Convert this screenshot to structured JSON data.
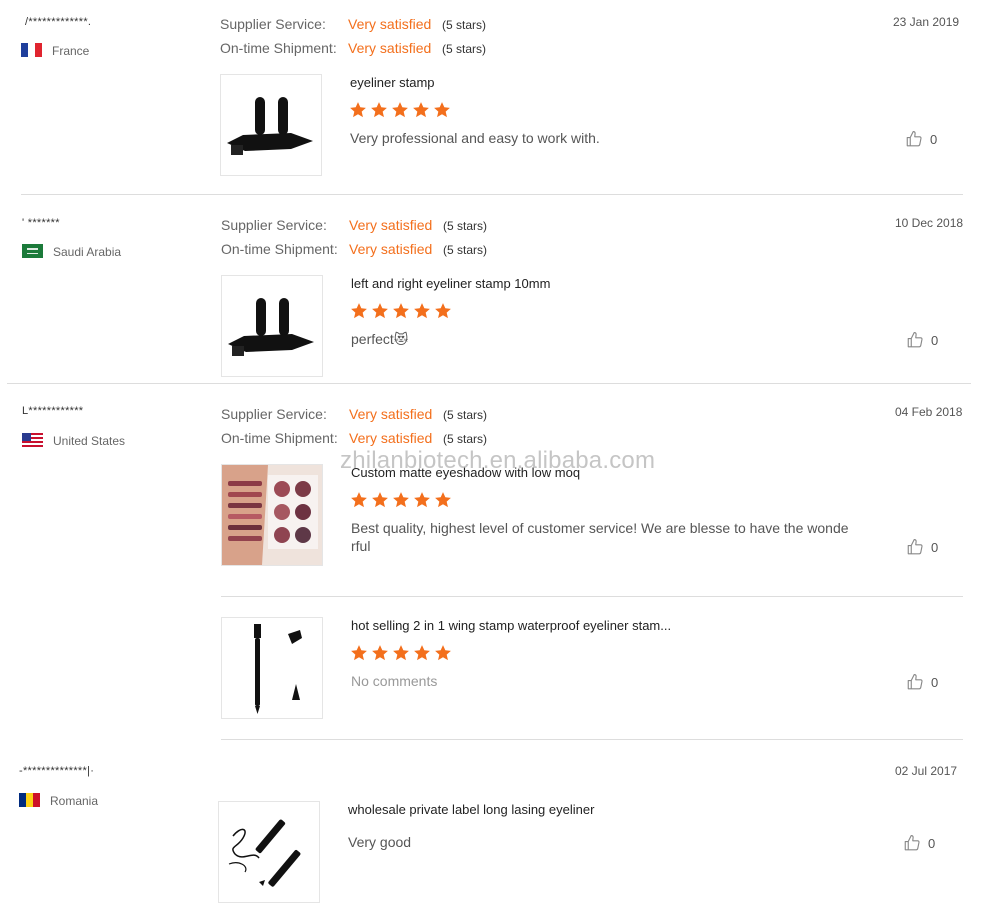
{
  "labels": {
    "supplier_service": "Supplier Service:",
    "ontime_shipment": "On-time Shipment:"
  },
  "colors": {
    "accent": "#f36f1c",
    "star": "#f36f1c"
  },
  "reviews": [
    {
      "buyer": "/*************.",
      "country": "France",
      "date": "23 Jan 2019",
      "supplier_rating": "Very satisfied",
      "supplier_stars": "(5 stars)",
      "shipment_rating": "Very satisfied",
      "shipment_stars": "(5 stars)",
      "items": [
        {
          "product": "eyeliner stamp",
          "stars": 5,
          "comment": "Very professional and easy to work with.",
          "likes": "0",
          "image": "eyeliner-stamp-photo"
        }
      ]
    },
    {
      "buyer": "' *******",
      "country": "Saudi Arabia",
      "date": "10 Dec 2018",
      "supplier_rating": "Very satisfied",
      "supplier_stars": "(5 stars)",
      "shipment_rating": "Very satisfied",
      "shipment_stars": "(5 stars)",
      "items": [
        {
          "product": "left and right eyeliner stamp 10mm",
          "stars": 5,
          "comment": "perfect😻",
          "likes": "0",
          "image": "eyeliner-stamp-photo"
        }
      ]
    },
    {
      "buyer": "L************",
      "country": "United States",
      "date": "04 Feb 2018",
      "supplier_rating": "Very satisfied",
      "supplier_stars": "(5 stars)",
      "shipment_rating": "Very satisfied",
      "shipment_stars": "(5 stars)",
      "items": [
        {
          "product": "Custom matte eyeshadow with low moq",
          "stars": 5,
          "comment": "Best quality, highest level of customer service! We are blesse to have the wonde rful",
          "likes": "0",
          "image": "eyeshadow-swatch-photo"
        },
        {
          "product": "hot selling 2 in 1 wing stamp waterproof eyeliner stam...",
          "stars": 5,
          "comment": "No comments",
          "likes": "0",
          "image": "eyeliner-pen-photo"
        }
      ]
    },
    {
      "buyer": "-**************|·",
      "country": "Romania",
      "date": "02 Jul 2017",
      "items": [
        {
          "product": "wholesale private label long lasing eyeliner",
          "comment": "Very good",
          "likes": "0",
          "image": "liquid-eyeliner-photo"
        }
      ]
    }
  ],
  "watermark": "zhilanbiotech.en.alibaba.com"
}
